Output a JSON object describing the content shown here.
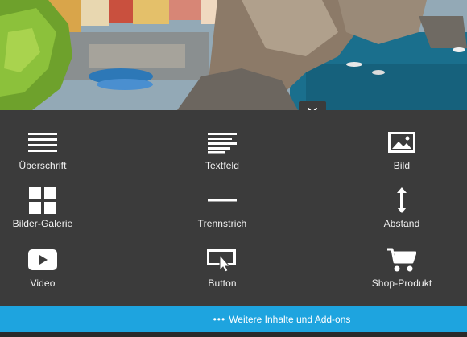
{
  "hero": {
    "image": "coastal-village-photo"
  },
  "close": {
    "icon": "close-icon"
  },
  "panel": {
    "items": [
      {
        "label": "Überschrift",
        "icon": "heading-icon"
      },
      {
        "label": "Textfeld",
        "icon": "text-block-icon"
      },
      {
        "label": "Bild",
        "icon": "image-icon"
      },
      {
        "label": "Bilder-Galerie",
        "icon": "gallery-icon"
      },
      {
        "label": "Trennstrich",
        "icon": "divider-icon"
      },
      {
        "label": "Abstand",
        "icon": "spacing-icon"
      },
      {
        "label": "Video",
        "icon": "video-icon"
      },
      {
        "label": "Button",
        "icon": "button-icon"
      },
      {
        "label": "Shop-Produkt",
        "icon": "shopping-cart-icon"
      }
    ]
  },
  "more": {
    "dots": "•••",
    "label": "Weitere Inhalte und Add-ons"
  },
  "colors": {
    "panel": "#3b3b3b",
    "accent": "#1ea4df",
    "text": "#f2f2f2"
  }
}
